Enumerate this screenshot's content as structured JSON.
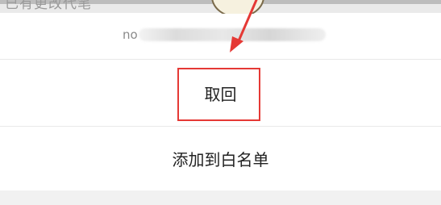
{
  "background_page": {
    "text": "已有更改代笔"
  },
  "sheet": {
    "number_prefix": "no",
    "actions": [
      {
        "label": "取回",
        "highlighted": true
      },
      {
        "label": "添加到白名单",
        "highlighted": false
      }
    ]
  },
  "annotation": {
    "color": "#e53935"
  }
}
